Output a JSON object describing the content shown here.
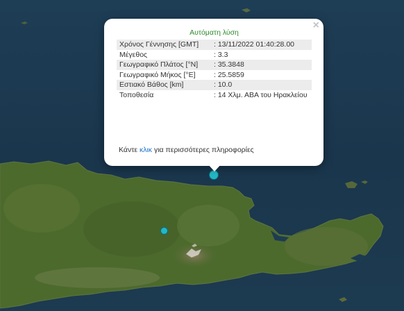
{
  "popup": {
    "close_label": "×",
    "title": "Αυτόματη λύση",
    "rows": [
      {
        "label": "Χρόνος Γέννησης [GMT]",
        "value": ": 13/11/2022 01:40:28.00"
      },
      {
        "label": "Μέγεθος",
        "value": ": 3.3"
      },
      {
        "label": "Γεωγραφικό Πλάτος [°N]",
        "value": ": 35.3848"
      },
      {
        "label": "Γεωγραφικό Μήκος [°E]",
        "value": ": 25.5859"
      },
      {
        "label": "Εστιακό Βάθος [km]",
        "value": ": 10.0"
      },
      {
        "label": "Τοποθεσία",
        "value": ": 14 Χλμ. ΑΒΑ του Ηρακλείου"
      }
    ],
    "more_prefix": "Κάντε ",
    "more_link": "κλικ",
    "more_suffix": " για περισσότερες πληροφορίες"
  },
  "colors": {
    "sea": "#1b3a52",
    "land": "#4c6a2c",
    "marker": "#23b8c8"
  }
}
